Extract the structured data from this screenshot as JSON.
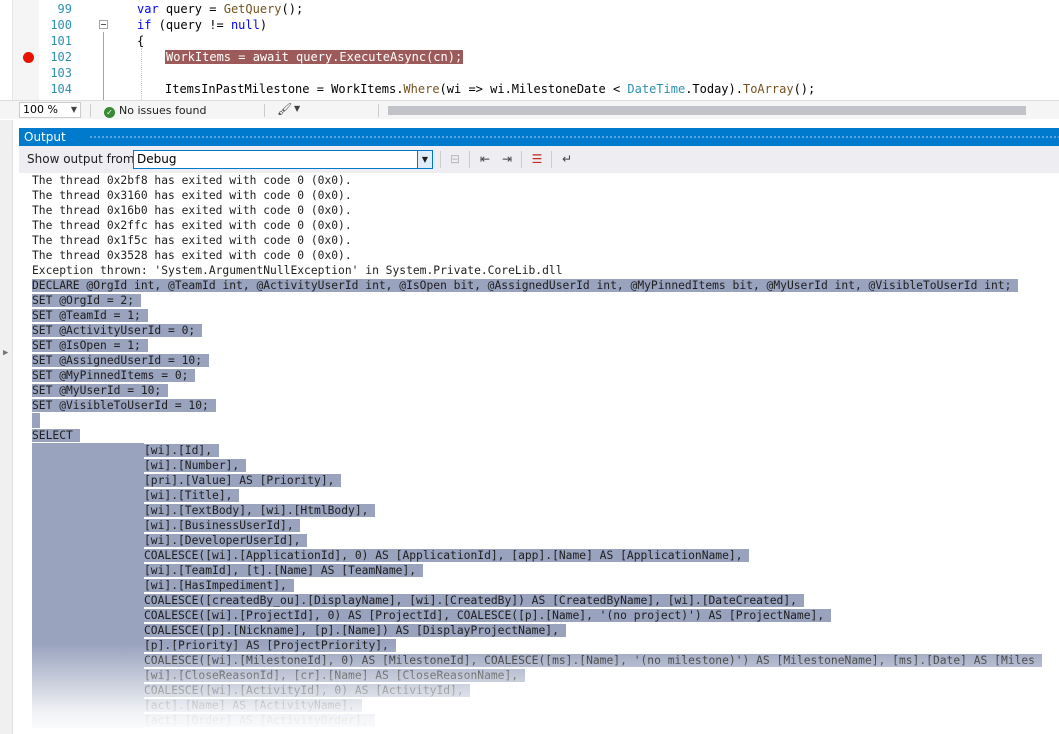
{
  "editor": {
    "lines": [
      {
        "num": "99",
        "parts": [
          {
            "t": "var",
            "c": "kw"
          },
          {
            "t": " query = "
          },
          {
            "t": "GetQuery",
            "c": "mt"
          },
          {
            "t": "();"
          }
        ]
      },
      {
        "num": "100",
        "parts": [
          {
            "t": "if",
            "c": "kw"
          },
          {
            "t": " (query != "
          },
          {
            "t": "null",
            "c": "kw"
          },
          {
            "t": ")"
          }
        ]
      },
      {
        "num": "101",
        "parts": [
          {
            "t": "{"
          }
        ]
      },
      {
        "num": "102",
        "parts": [
          {
            "t": "WorkItems = await query.ExecuteAsync(cn);",
            "c": "hl-break"
          }
        ]
      },
      {
        "num": "103",
        "parts": []
      },
      {
        "num": "104",
        "parts": [
          {
            "t": "ItemsInPastMilestone = WorkItems."
          },
          {
            "t": "Where",
            "c": "mt"
          },
          {
            "t": "(wi => wi.MilestoneDate < "
          },
          {
            "t": "DateTime",
            "c": "ty"
          },
          {
            "t": ".Today)."
          },
          {
            "t": "ToArray",
            "c": "mt"
          },
          {
            "t": "();"
          }
        ]
      }
    ]
  },
  "status": {
    "zoom": "100 %",
    "issues": "No issues found"
  },
  "output": {
    "title": "Output",
    "show_label": "Show output from:",
    "source": "Debug",
    "plain_lines": [
      "The thread 0x2bf8 has exited with code 0 (0x0).",
      "The thread 0x3160 has exited with code 0 (0x0).",
      "The thread 0x16b0 has exited with code 0 (0x0).",
      "The thread 0x2ffc has exited with code 0 (0x0).",
      "The thread 0x1f5c has exited with code 0 (0x0).",
      "The thread 0x3528 has exited with code 0 (0x0).",
      "Exception thrown: 'System.ArgumentNullException' in System.Private.CoreLib.dll"
    ],
    "selected_lines": [
      "DECLARE @OrgId int, @TeamId int, @ActivityUserId int, @IsOpen bit, @AssignedUserId int, @MyPinnedItems bit, @MyUserId int, @VisibleToUserId int;",
      "SET @OrgId = 2;",
      "SET @TeamId = 1;",
      "SET @ActivityUserId = 0;",
      "SET @IsOpen = 1;",
      "SET @AssignedUserId = 10;",
      "SET @MyPinnedItems = 0;",
      "SET @MyUserId = 10;",
      "SET @VisibleToUserId = 10;",
      "",
      "SELECT",
      "\t\t\t\t[wi].[Id],",
      "\t\t\t\t[wi].[Number],",
      "\t\t\t\t[pri].[Value] AS [Priority],",
      "\t\t\t\t[wi].[Title],",
      "\t\t\t\t[wi].[TextBody], [wi].[HtmlBody],",
      "\t\t\t\t[wi].[BusinessUserId],",
      "\t\t\t\t[wi].[DeveloperUserId],",
      "\t\t\t\tCOALESCE([wi].[ApplicationId], 0) AS [ApplicationId], [app].[Name] AS [ApplicationName],",
      "\t\t\t\t[wi].[TeamId], [t].[Name] AS [TeamName],",
      "\t\t\t\t[wi].[HasImpediment],",
      "\t\t\t\tCOALESCE([createdBy_ou].[DisplayName], [wi].[CreatedBy]) AS [CreatedByName], [wi].[DateCreated],",
      "\t\t\t\tCOALESCE([wi].[ProjectId], 0) AS [ProjectId], COALESCE([p].[Name], '(no project)') AS [ProjectName],",
      "\t\t\t\tCOALESCE([p].[Nickname], [p].[Name]) AS [DisplayProjectName],",
      "\t\t\t\t[p].[Priority] AS [ProjectPriority],",
      "\t\t\t\tCOALESCE([wi].[MilestoneId], 0) AS [MilestoneId], COALESCE([ms].[Name], '(no milestone)') AS [MilestoneName], [ms].[Date] AS [Miles",
      "\t\t\t\t[wi].[CloseReasonId], [cr].[Name] AS [CloseReasonName],",
      "\t\t\t\tCOALESCE([wi].[ActivityId], 0) AS [ActivityId],",
      "\t\t\t\t[act].[Name] AS [ActivityName],",
      "\t\t\t\t[act].[Order] AS [ActivityOrder],"
    ]
  },
  "icons": {
    "toolbar": [
      "find-message-icon",
      "prev-message-icon",
      "next-message-icon",
      "clear-all-icon",
      "toggle-word-wrap-icon"
    ]
  },
  "colors": {
    "accent": "#007acc",
    "selection": "#99a3be",
    "breakpoint": "#e51400",
    "breakpoint_highlight": "#9c5a5a",
    "line_number": "#2b91af",
    "keyword": "#0000ff"
  }
}
